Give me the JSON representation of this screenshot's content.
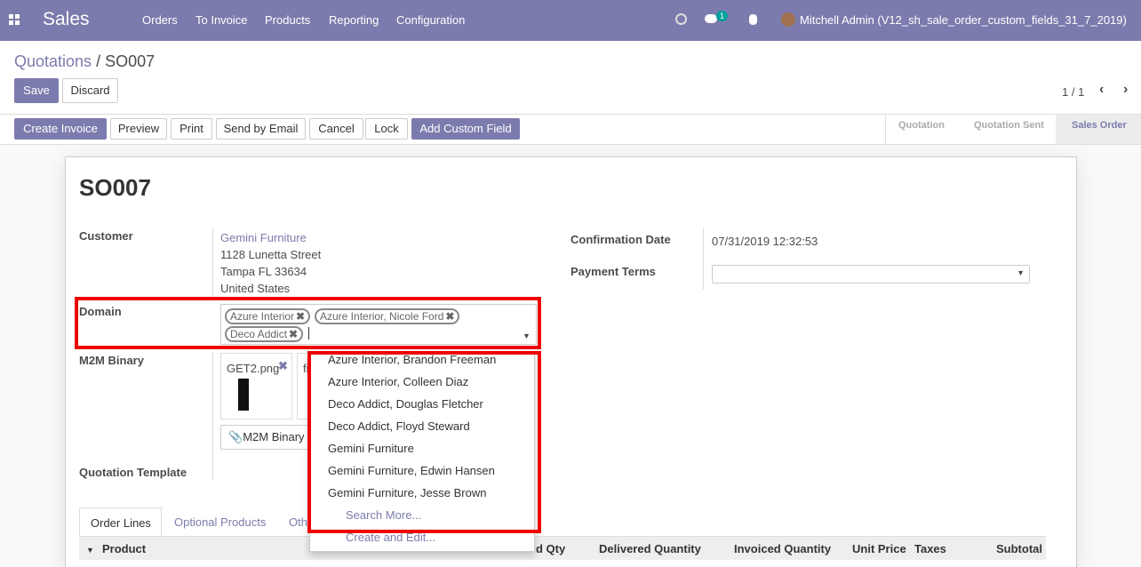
{
  "topbar": {
    "brand": "Sales",
    "menu": [
      "Orders",
      "To Invoice",
      "Products",
      "Reporting",
      "Configuration"
    ],
    "badge": "1",
    "user": "Mitchell Admin (V12_sh_sale_order_custom_fields_31_7_2019)"
  },
  "breadcrumb": {
    "parent": "Quotations",
    "sep": "/",
    "current": "SO007"
  },
  "buttons": {
    "save": "Save",
    "discard": "Discard",
    "pager": "1 / 1"
  },
  "actions": [
    "Create Invoice",
    "Preview",
    "Print",
    "Send by Email",
    "Cancel",
    "Lock",
    "Add Custom Field"
  ],
  "stages": [
    "Quotation",
    "Quotation Sent",
    "Sales Order"
  ],
  "form": {
    "title": "SO007",
    "customer_label": "Customer",
    "customer_name": "Gemini Furniture",
    "addr1": "1128 Lunetta Street",
    "addr2": "Tampa FL 33634",
    "addr3": "United States",
    "domain_label": "Domain",
    "tags": [
      "Azure Interior",
      "Azure Interior, Nicole Ford",
      "Deco Addict"
    ],
    "m2m_label": "M2M Binary",
    "file1": "GET2.png",
    "file2": "fi",
    "m2m_button": "M2M Binary",
    "template_label": "Quotation Template",
    "confirm_label": "Confirmation Date",
    "confirm_value": "07/31/2019 12:32:53",
    "payment_label": "Payment Terms"
  },
  "dropdown": [
    "Azure Interior, Brandon Freeman",
    "Azure Interior, Colleen Diaz",
    "Deco Addict, Douglas Fletcher",
    "Deco Addict, Floyd Steward",
    "Gemini Furniture",
    "Gemini Furniture, Edwin Hansen",
    "Gemini Furniture, Jesse Brown"
  ],
  "dropdown_search": "Search More...",
  "dropdown_create": "Create and Edit...",
  "tabs": [
    "Order Lines",
    "Optional Products",
    "Oth"
  ],
  "columns": [
    "Product",
    "d Qty",
    "Delivered Quantity",
    "Invoiced Quantity",
    "Unit Price",
    "Taxes",
    "Subtotal"
  ]
}
